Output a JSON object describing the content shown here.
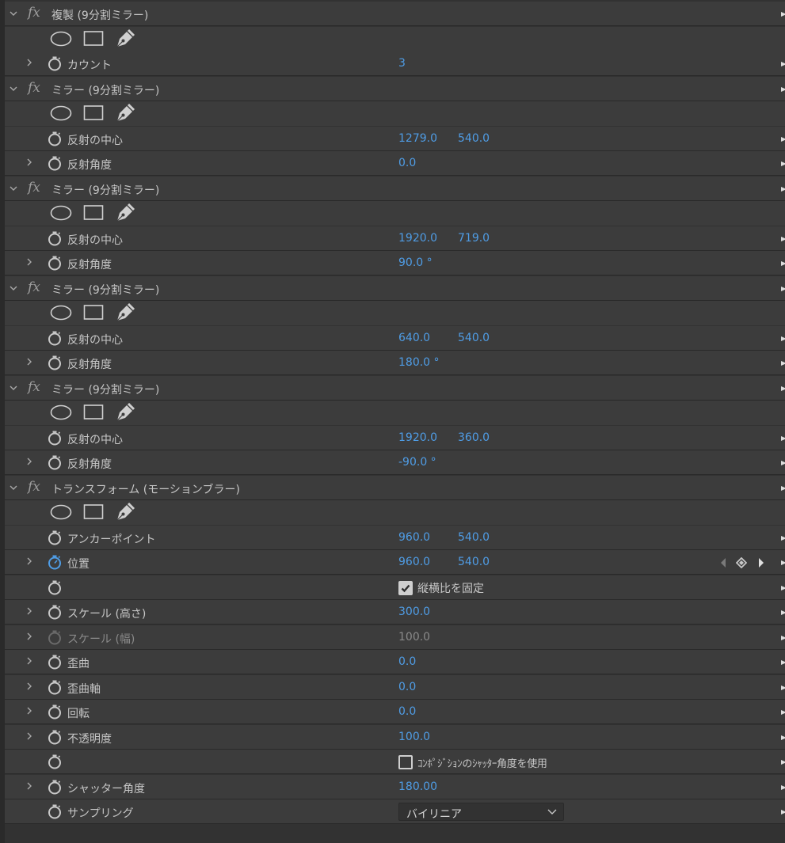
{
  "colors": {
    "background": "#3c3c3c",
    "value": "#4f9de6",
    "text": "#c6c6c6"
  },
  "effects": [
    {
      "title": "複製 (9分割ミラー)",
      "props": [
        {
          "twirl": true,
          "label": "カウント",
          "v1": "3"
        }
      ]
    },
    {
      "title": "ミラー (9分割ミラー)",
      "props": [
        {
          "twirl": false,
          "label": "反射の中心",
          "v1": "1279.0",
          "v2": "540.0"
        },
        {
          "twirl": true,
          "label": "反射角度",
          "v1": "0.0"
        }
      ]
    },
    {
      "title": "ミラー (9分割ミラー)",
      "props": [
        {
          "twirl": false,
          "label": "反射の中心",
          "v1": "1920.0",
          "v2": "719.0"
        },
        {
          "twirl": true,
          "label": "反射角度",
          "v1": "90.0 °"
        }
      ]
    },
    {
      "title": "ミラー (9分割ミラー)",
      "props": [
        {
          "twirl": false,
          "label": "反射の中心",
          "v1": "640.0",
          "v2": "540.0"
        },
        {
          "twirl": true,
          "label": "反射角度",
          "v1": "180.0 °"
        }
      ]
    },
    {
      "title": "ミラー (9分割ミラー)",
      "props": [
        {
          "twirl": false,
          "label": "反射の中心",
          "v1": "1920.0",
          "v2": "360.0"
        },
        {
          "twirl": true,
          "label": "反射角度",
          "v1": "-90.0 °"
        }
      ]
    },
    {
      "title": "トランスフォーム (モーションブラー)",
      "props": [
        {
          "twirl": false,
          "label": "アンカーポイント",
          "v1": "960.0",
          "v2": "540.0"
        },
        {
          "twirl": true,
          "label": "位置",
          "v1": "960.0",
          "v2": "540.0",
          "keyframed": true
        },
        {
          "twirl": false,
          "label": "",
          "checkbox": true,
          "checked": true,
          "checkLabel": "縦横比を固定"
        },
        {
          "twirl": true,
          "label": "スケール (高さ)",
          "v1": "300.0"
        },
        {
          "twirl": true,
          "label": "スケール (幅)",
          "v1": "100.0",
          "disabled": true
        },
        {
          "twirl": true,
          "label": "歪曲",
          "v1": "0.0"
        },
        {
          "twirl": true,
          "label": "歪曲軸",
          "v1": "0.0"
        },
        {
          "twirl": true,
          "label": "回転",
          "v1": "0.0"
        },
        {
          "twirl": true,
          "label": "不透明度",
          "v1": "100.0"
        },
        {
          "twirl": false,
          "label": "",
          "checkbox": true,
          "checked": false,
          "checkLabel": "ｺﾝﾎﾟｼﾞｼｮﾝのｼｬｯﾀｰ角度を使用",
          "small": true
        },
        {
          "twirl": true,
          "label": "シャッター角度",
          "v1": "180.00"
        },
        {
          "twirl": false,
          "label": "サンプリング",
          "dropdown": "バイリニア"
        }
      ]
    }
  ]
}
